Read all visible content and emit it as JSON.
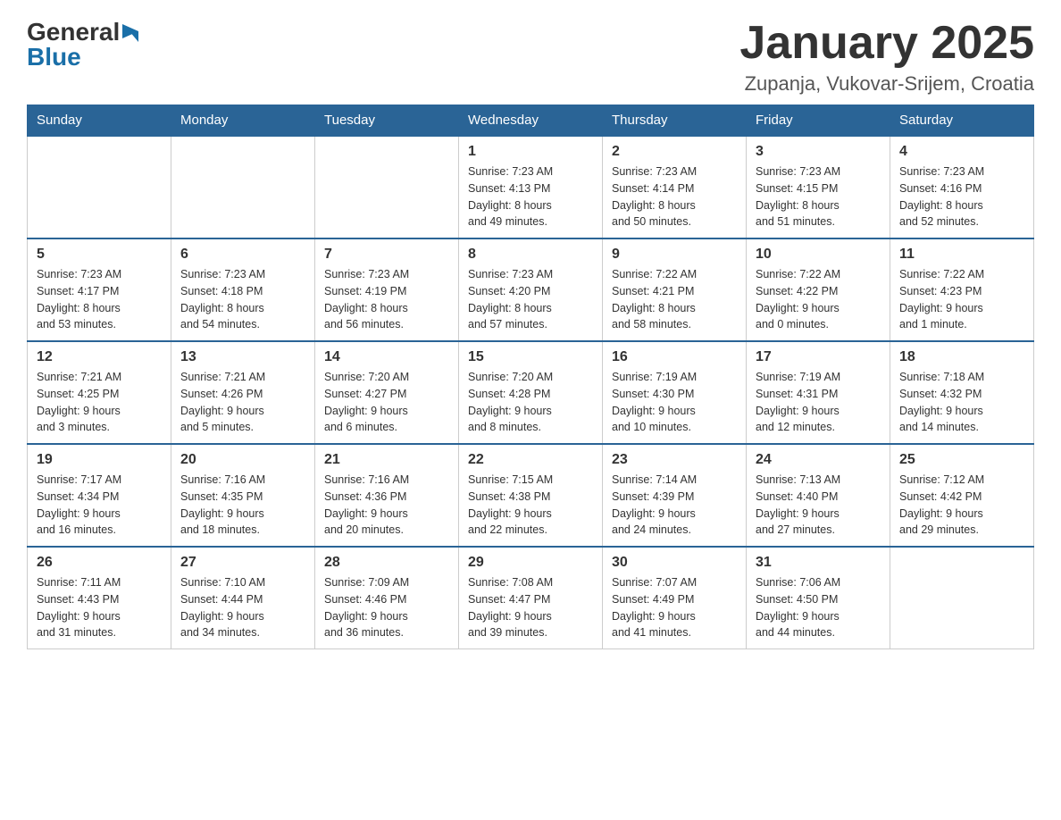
{
  "header": {
    "title": "January 2025",
    "subtitle": "Zupanja, Vukovar-Srijem, Croatia",
    "logo_general": "General",
    "logo_blue": "Blue"
  },
  "days_of_week": [
    "Sunday",
    "Monday",
    "Tuesday",
    "Wednesday",
    "Thursday",
    "Friday",
    "Saturday"
  ],
  "weeks": [
    [
      {
        "day": "",
        "info": ""
      },
      {
        "day": "",
        "info": ""
      },
      {
        "day": "",
        "info": ""
      },
      {
        "day": "1",
        "info": "Sunrise: 7:23 AM\nSunset: 4:13 PM\nDaylight: 8 hours\nand 49 minutes."
      },
      {
        "day": "2",
        "info": "Sunrise: 7:23 AM\nSunset: 4:14 PM\nDaylight: 8 hours\nand 50 minutes."
      },
      {
        "day": "3",
        "info": "Sunrise: 7:23 AM\nSunset: 4:15 PM\nDaylight: 8 hours\nand 51 minutes."
      },
      {
        "day": "4",
        "info": "Sunrise: 7:23 AM\nSunset: 4:16 PM\nDaylight: 8 hours\nand 52 minutes."
      }
    ],
    [
      {
        "day": "5",
        "info": "Sunrise: 7:23 AM\nSunset: 4:17 PM\nDaylight: 8 hours\nand 53 minutes."
      },
      {
        "day": "6",
        "info": "Sunrise: 7:23 AM\nSunset: 4:18 PM\nDaylight: 8 hours\nand 54 minutes."
      },
      {
        "day": "7",
        "info": "Sunrise: 7:23 AM\nSunset: 4:19 PM\nDaylight: 8 hours\nand 56 minutes."
      },
      {
        "day": "8",
        "info": "Sunrise: 7:23 AM\nSunset: 4:20 PM\nDaylight: 8 hours\nand 57 minutes."
      },
      {
        "day": "9",
        "info": "Sunrise: 7:22 AM\nSunset: 4:21 PM\nDaylight: 8 hours\nand 58 minutes."
      },
      {
        "day": "10",
        "info": "Sunrise: 7:22 AM\nSunset: 4:22 PM\nDaylight: 9 hours\nand 0 minutes."
      },
      {
        "day": "11",
        "info": "Sunrise: 7:22 AM\nSunset: 4:23 PM\nDaylight: 9 hours\nand 1 minute."
      }
    ],
    [
      {
        "day": "12",
        "info": "Sunrise: 7:21 AM\nSunset: 4:25 PM\nDaylight: 9 hours\nand 3 minutes."
      },
      {
        "day": "13",
        "info": "Sunrise: 7:21 AM\nSunset: 4:26 PM\nDaylight: 9 hours\nand 5 minutes."
      },
      {
        "day": "14",
        "info": "Sunrise: 7:20 AM\nSunset: 4:27 PM\nDaylight: 9 hours\nand 6 minutes."
      },
      {
        "day": "15",
        "info": "Sunrise: 7:20 AM\nSunset: 4:28 PM\nDaylight: 9 hours\nand 8 minutes."
      },
      {
        "day": "16",
        "info": "Sunrise: 7:19 AM\nSunset: 4:30 PM\nDaylight: 9 hours\nand 10 minutes."
      },
      {
        "day": "17",
        "info": "Sunrise: 7:19 AM\nSunset: 4:31 PM\nDaylight: 9 hours\nand 12 minutes."
      },
      {
        "day": "18",
        "info": "Sunrise: 7:18 AM\nSunset: 4:32 PM\nDaylight: 9 hours\nand 14 minutes."
      }
    ],
    [
      {
        "day": "19",
        "info": "Sunrise: 7:17 AM\nSunset: 4:34 PM\nDaylight: 9 hours\nand 16 minutes."
      },
      {
        "day": "20",
        "info": "Sunrise: 7:16 AM\nSunset: 4:35 PM\nDaylight: 9 hours\nand 18 minutes."
      },
      {
        "day": "21",
        "info": "Sunrise: 7:16 AM\nSunset: 4:36 PM\nDaylight: 9 hours\nand 20 minutes."
      },
      {
        "day": "22",
        "info": "Sunrise: 7:15 AM\nSunset: 4:38 PM\nDaylight: 9 hours\nand 22 minutes."
      },
      {
        "day": "23",
        "info": "Sunrise: 7:14 AM\nSunset: 4:39 PM\nDaylight: 9 hours\nand 24 minutes."
      },
      {
        "day": "24",
        "info": "Sunrise: 7:13 AM\nSunset: 4:40 PM\nDaylight: 9 hours\nand 27 minutes."
      },
      {
        "day": "25",
        "info": "Sunrise: 7:12 AM\nSunset: 4:42 PM\nDaylight: 9 hours\nand 29 minutes."
      }
    ],
    [
      {
        "day": "26",
        "info": "Sunrise: 7:11 AM\nSunset: 4:43 PM\nDaylight: 9 hours\nand 31 minutes."
      },
      {
        "day": "27",
        "info": "Sunrise: 7:10 AM\nSunset: 4:44 PM\nDaylight: 9 hours\nand 34 minutes."
      },
      {
        "day": "28",
        "info": "Sunrise: 7:09 AM\nSunset: 4:46 PM\nDaylight: 9 hours\nand 36 minutes."
      },
      {
        "day": "29",
        "info": "Sunrise: 7:08 AM\nSunset: 4:47 PM\nDaylight: 9 hours\nand 39 minutes."
      },
      {
        "day": "30",
        "info": "Sunrise: 7:07 AM\nSunset: 4:49 PM\nDaylight: 9 hours\nand 41 minutes."
      },
      {
        "day": "31",
        "info": "Sunrise: 7:06 AM\nSunset: 4:50 PM\nDaylight: 9 hours\nand 44 minutes."
      },
      {
        "day": "",
        "info": ""
      }
    ]
  ]
}
